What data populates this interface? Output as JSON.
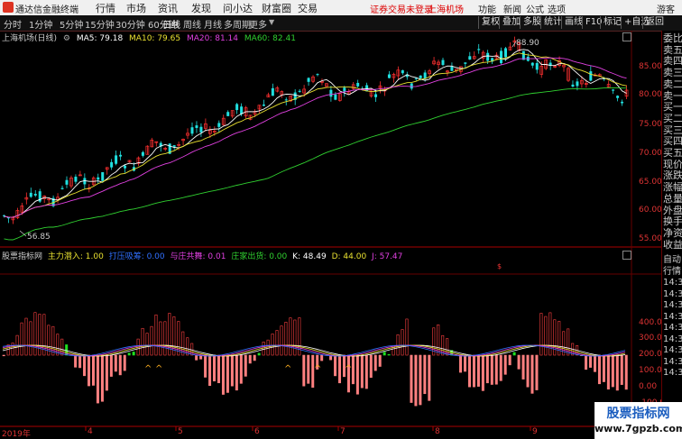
{
  "titlebar": {
    "app_name": "通达信金融终端",
    "menus": [
      "行情",
      "市场",
      "资讯",
      "发现",
      "问小达",
      "财富圈",
      "交易"
    ],
    "warning": "证券交易未登录",
    "stock_name": "上海机场",
    "right_items": [
      "功能",
      "新闻",
      "公式",
      "选项"
    ],
    "guest": "游客"
  },
  "toolbar": {
    "timeframes": [
      "分时",
      "1分钟",
      "5分钟",
      "15分钟",
      "30分钟",
      "60分钟",
      "日线",
      "周线",
      "月线",
      "多周期",
      "更多"
    ],
    "active": "日线",
    "right_buttons": [
      "复权",
      "叠加",
      "多股",
      "统计",
      "画线",
      "F10",
      "标记",
      "+自选",
      "返回"
    ]
  },
  "chart": {
    "title": "上海机场(日线)",
    "ma5_label": "MA5: 79.18",
    "ma10_label": "MA10: 79.65",
    "ma20_label": "MA20: 81.14",
    "ma60_label": "MA60: 82.41",
    "high_label": "88.90",
    "low_label": "56.85",
    "y_ticks": [
      "85.00",
      "80.00",
      "75.00",
      "70.00",
      "65.00",
      "60.00",
      "55.00"
    ],
    "colors": {
      "ma5": "#ffffff",
      "ma10": "#e8e030",
      "ma20": "#e040e0",
      "ma60": "#30d030",
      "up": "#ff3030",
      "down": "#20e0e0"
    }
  },
  "indicator": {
    "name": "股票指标网",
    "items": [
      {
        "label": "主力潜入: 1.00",
        "color": "#e8e030"
      },
      {
        "label": "打压吸筹: 0.00",
        "color": "#3070ff"
      },
      {
        "label": "与庄共舞: 0.01",
        "color": "#e040e0"
      },
      {
        "label": "庄家出货: 0.00",
        "color": "#30d030"
      },
      {
        "label": "K: 48.49",
        "color": "#ffffff"
      },
      {
        "label": "D: 44.00",
        "color": "#e8e030"
      },
      {
        "label": "J: 57.47",
        "color": "#e040e0"
      }
    ],
    "y_ticks": [
      "400.00",
      "300.00",
      "200.00",
      "100.00",
      "0.00",
      "-100.00"
    ]
  },
  "x_axis": {
    "year": "2019年",
    "months": [
      "4",
      "5",
      "6",
      "7",
      "8",
      "9"
    ]
  },
  "right_panel": {
    "top_items": [
      "委比",
      "卖五",
      "卖四",
      "卖三",
      "卖二",
      "卖一",
      "买一",
      "买二",
      "买三",
      "买四",
      "买五",
      "现价",
      "涨跌",
      "涨幅",
      "总量",
      "外盘",
      "换手",
      "净资",
      "收益"
    ],
    "bottom_items": [
      "自动",
      "行情",
      "14:30",
      "14:30",
      "14:30",
      "14:30",
      "14:30",
      "14:30",
      "14:31",
      "14:31",
      "14:31"
    ]
  },
  "watermark": {
    "line1": "股票指标网",
    "line2": "www.7gpzb.com"
  }
}
